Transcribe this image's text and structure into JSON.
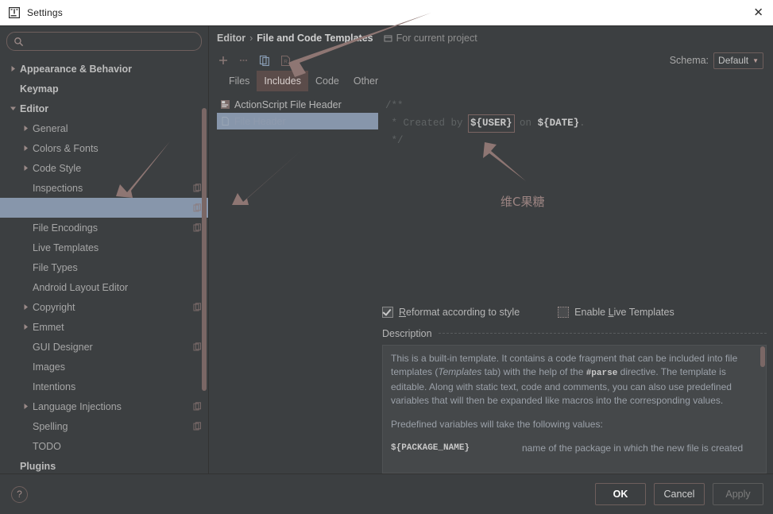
{
  "window": {
    "title": "Settings",
    "icon": "intellij-logo-icon",
    "close_label": "✕"
  },
  "search": {
    "placeholder": "",
    "value": "",
    "icon": "search-icon"
  },
  "sidebar": {
    "items": [
      {
        "label": "Appearance & Behavior",
        "indent": 0,
        "twisty": "collapsed",
        "bold": true,
        "badge": false,
        "selected": false
      },
      {
        "label": "Keymap",
        "indent": 0,
        "twisty": "none",
        "bold": true,
        "badge": false,
        "selected": false
      },
      {
        "label": "Editor",
        "indent": 0,
        "twisty": "expanded",
        "bold": true,
        "badge": false,
        "selected": false
      },
      {
        "label": "General",
        "indent": 1,
        "twisty": "collapsed",
        "bold": false,
        "badge": false,
        "selected": false
      },
      {
        "label": "Colors & Fonts",
        "indent": 1,
        "twisty": "collapsed",
        "bold": false,
        "badge": false,
        "selected": false
      },
      {
        "label": "Code Style",
        "indent": 1,
        "twisty": "collapsed",
        "bold": false,
        "badge": false,
        "selected": false
      },
      {
        "label": "Inspections",
        "indent": 1,
        "twisty": "none",
        "bold": false,
        "badge": true,
        "selected": false
      },
      {
        "label": "",
        "indent": 1,
        "twisty": "none",
        "bold": false,
        "badge": true,
        "selected": true
      },
      {
        "label": "File Encodings",
        "indent": 1,
        "twisty": "none",
        "bold": false,
        "badge": true,
        "selected": false
      },
      {
        "label": "Live Templates",
        "indent": 1,
        "twisty": "none",
        "bold": false,
        "badge": false,
        "selected": false
      },
      {
        "label": "File Types",
        "indent": 1,
        "twisty": "none",
        "bold": false,
        "badge": false,
        "selected": false
      },
      {
        "label": "Android Layout Editor",
        "indent": 1,
        "twisty": "none",
        "bold": false,
        "badge": false,
        "selected": false
      },
      {
        "label": "Copyright",
        "indent": 1,
        "twisty": "collapsed",
        "bold": false,
        "badge": true,
        "selected": false
      },
      {
        "label": "Emmet",
        "indent": 1,
        "twisty": "collapsed",
        "bold": false,
        "badge": false,
        "selected": false
      },
      {
        "label": "GUI Designer",
        "indent": 1,
        "twisty": "none",
        "bold": false,
        "badge": true,
        "selected": false
      },
      {
        "label": "Images",
        "indent": 1,
        "twisty": "none",
        "bold": false,
        "badge": false,
        "selected": false
      },
      {
        "label": "Intentions",
        "indent": 1,
        "twisty": "none",
        "bold": false,
        "badge": false,
        "selected": false
      },
      {
        "label": "Language Injections",
        "indent": 1,
        "twisty": "collapsed",
        "bold": false,
        "badge": true,
        "selected": false
      },
      {
        "label": "Spelling",
        "indent": 1,
        "twisty": "none",
        "bold": false,
        "badge": true,
        "selected": false
      },
      {
        "label": "TODO",
        "indent": 1,
        "twisty": "none",
        "bold": false,
        "badge": false,
        "selected": false
      },
      {
        "label": "Plugins",
        "indent": 0,
        "twisty": "none",
        "bold": true,
        "badge": false,
        "selected": false
      }
    ]
  },
  "breadcrumb": {
    "parent": "Editor",
    "separator": "›",
    "current": "File and Code Templates",
    "scope_icon": "project-scope-icon",
    "scope_text": "For current project"
  },
  "toolbar": {
    "add_icon": "plus-icon",
    "remove_icon": "minus-icon",
    "copy_icon": "copy-template-icon",
    "reset_icon": "reset-template-icon",
    "schema_label": "Schema:",
    "schema_value": "Default",
    "schema_caret": "▼"
  },
  "tabs": [
    {
      "label": "Files",
      "active": false
    },
    {
      "label": "Includes",
      "active": true
    },
    {
      "label": "Code",
      "active": false
    },
    {
      "label": "Other",
      "active": false
    }
  ],
  "templates": [
    {
      "label": "ActionScript File Header",
      "icon": "actionscript-file-icon",
      "selected": false
    },
    {
      "label": "File Header",
      "icon": "file-header-icon",
      "selected": true
    }
  ],
  "editor": {
    "lines": [
      {
        "pre": "/**",
        "token": "",
        "mid": "",
        "token2": "",
        "post": ""
      },
      {
        "pre": " * Created by ",
        "token": "${USER}",
        "mid": " on ",
        "token2": "${DATE}",
        "post": "."
      },
      {
        "pre": " */",
        "token": "",
        "mid": "",
        "token2": "",
        "post": ""
      }
    ]
  },
  "options": {
    "reformat": {
      "label_pre": "R",
      "label_post": "eformat according to style",
      "checked": true
    },
    "live_templates": {
      "label_pre": "Enable ",
      "mnemonic": "L",
      "label_post": "ive Templates",
      "checked": false
    }
  },
  "description": {
    "title": "Description",
    "paragraph1_a": "This is a built-in template. It contains a code fragment that can be included into file templates (",
    "paragraph1_i": "Templates",
    "paragraph1_b": " tab) with the help of the ",
    "paragraph1_mono": "#parse",
    "paragraph1_c": " directive. The template is editable. Along with static text, code and comments, you can also use predefined variables that will then be expanded like macros into the corresponding values.",
    "paragraph2": "Predefined variables will take the following values:",
    "vars": [
      {
        "name": "${PACKAGE_NAME}",
        "desc": "name of the package in which the new file is created"
      }
    ]
  },
  "footer": {
    "help_label": "?",
    "ok_label": "OK",
    "cancel_label": "Cancel",
    "apply_label": "Apply"
  },
  "annotations": {
    "note_text": "维C果糖",
    "arrow_color": "#8e7673"
  }
}
